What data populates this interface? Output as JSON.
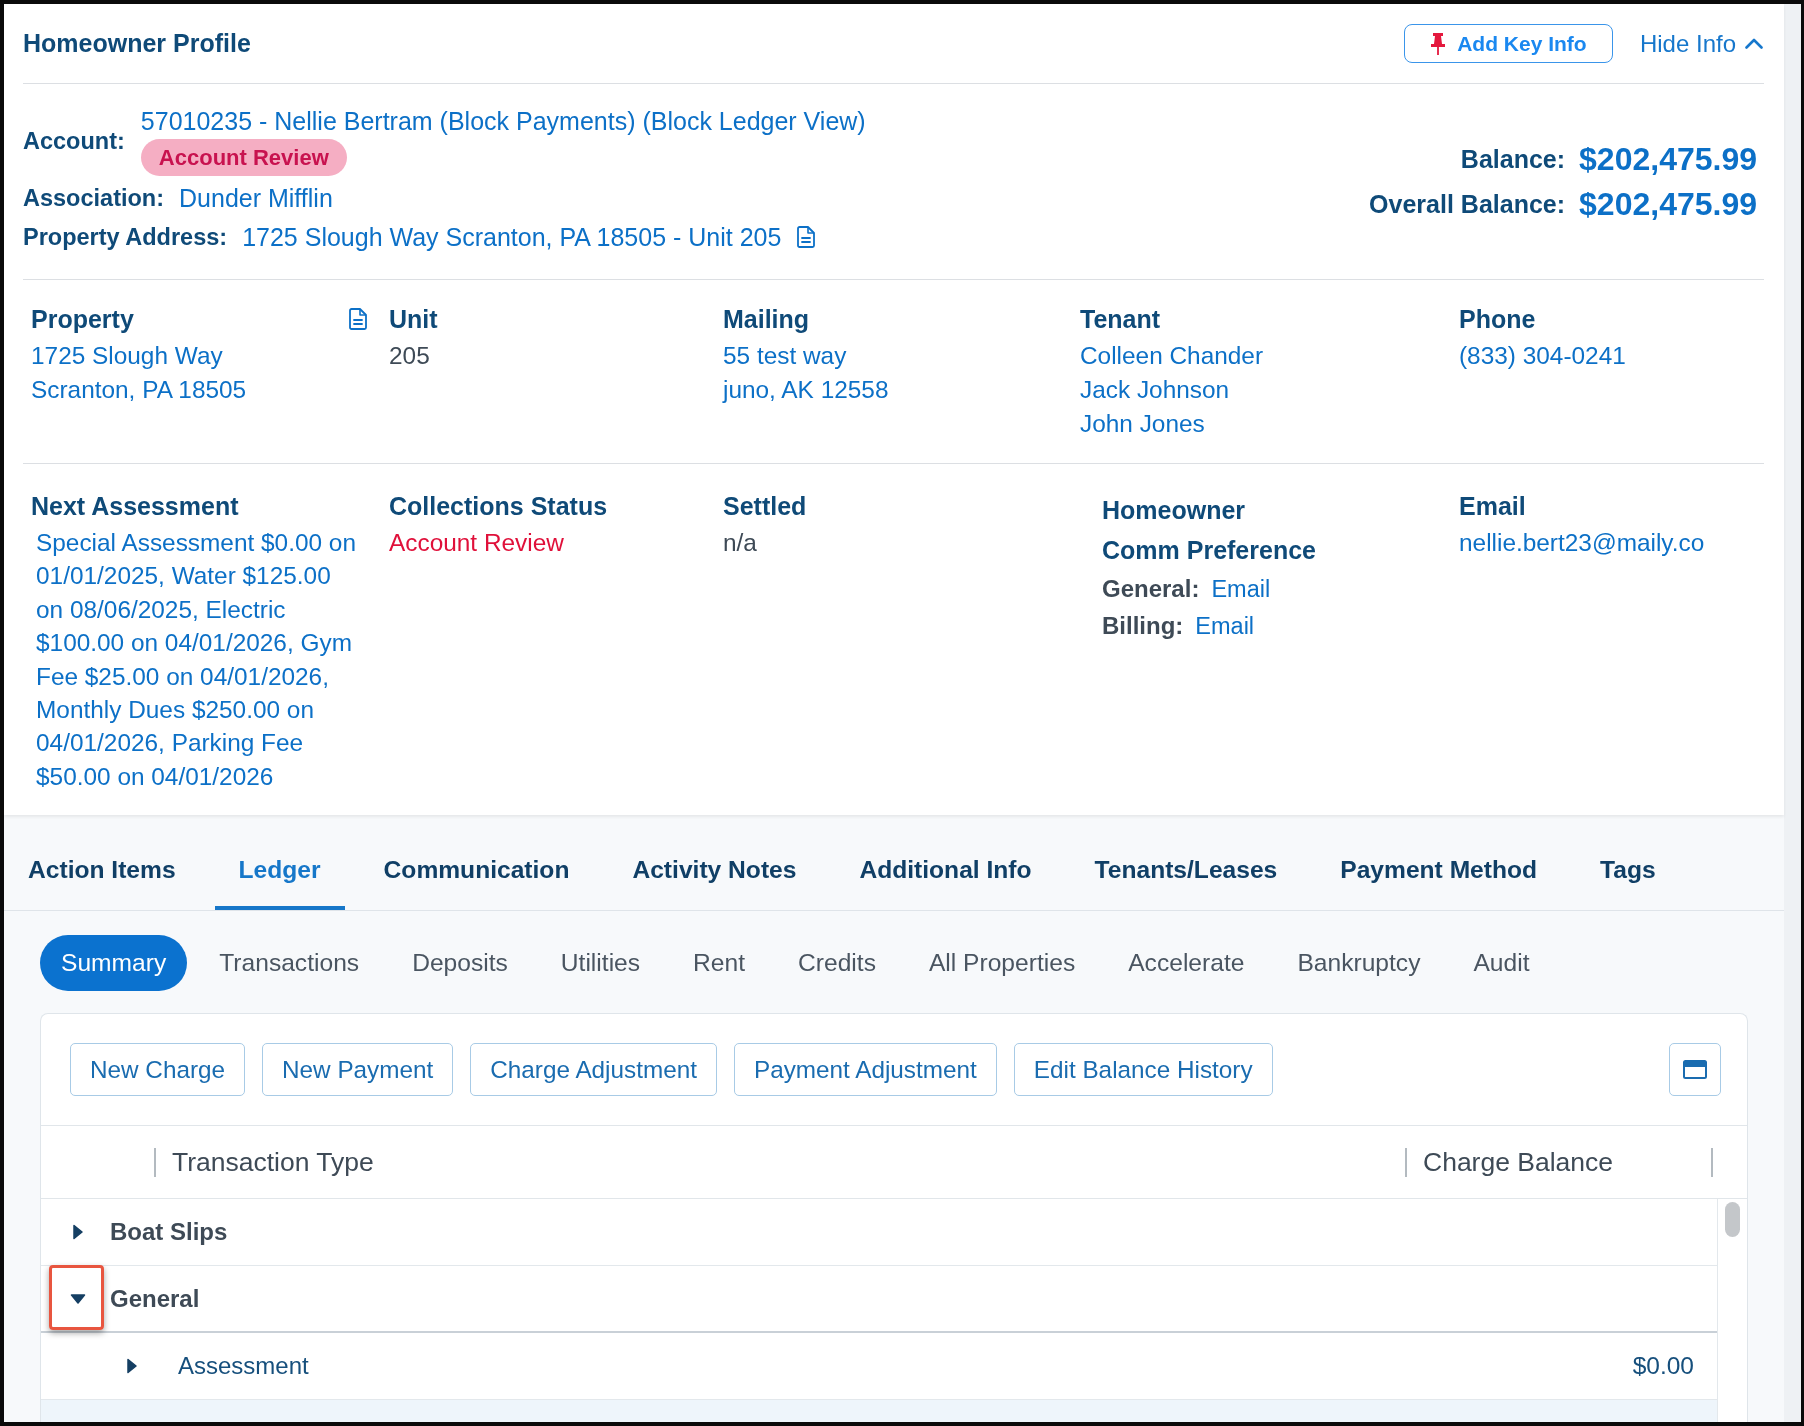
{
  "header": {
    "title": "Homeowner Profile",
    "add_key_info": "Add Key Info",
    "hide_info": "Hide Info"
  },
  "account": {
    "label": "Account:",
    "value": "57010235 - Nellie Bertram (Block Payments) (Block Ledger View)",
    "badge": "Account Review"
  },
  "association": {
    "label": "Association:",
    "value": "Dunder Mifflin"
  },
  "property_address": {
    "label": "Property Address:",
    "value": "1725 Slough Way Scranton, PA 18505 - Unit 205"
  },
  "balances": [
    {
      "label": "Balance:",
      "value": "$202,475.99"
    },
    {
      "label": "Overall Balance:",
      "value": "$202,475.99"
    }
  ],
  "details_rows": [
    [
      {
        "kind": "links",
        "heading": "Property",
        "doc_icon": true,
        "lines": [
          "1725 Slough Way",
          "Scranton, PA 18505"
        ]
      },
      {
        "kind": "text",
        "heading": "Unit",
        "lines": [
          "205"
        ]
      },
      {
        "kind": "links",
        "heading": "Mailing",
        "lines": [
          "55 test way",
          "juno, AK 12558"
        ]
      },
      {
        "kind": "links",
        "heading": "Tenant",
        "lines": [
          "Colleen Chander",
          "Jack Johnson",
          "John Jones"
        ]
      },
      {
        "kind": "links",
        "heading": "Phone",
        "lines": [
          "(833) 304-0241"
        ]
      }
    ],
    [
      {
        "kind": "links",
        "heading": "Next Assessment",
        "lines": [
          "Special Assessment $0.00 on 01/01/2025, Water $125.00 on 08/06/2025, Electric $100.00 on 04/01/2026, Gym Fee $25.00 on 04/01/2026, Monthly Dues $250.00 on 04/01/2026, Parking Fee $50.00 on 04/01/2026"
        ]
      },
      {
        "kind": "status",
        "heading": "Collections Status",
        "lines": [
          "Account Review"
        ]
      },
      {
        "kind": "text",
        "heading": "Settled",
        "lines": [
          "n/a"
        ]
      },
      {
        "kind": "preferences",
        "heading_lines": [
          "Homeowner",
          "Comm Preference"
        ],
        "preferences": [
          {
            "label": "General:",
            "value": "Email"
          },
          {
            "label": "Billing:",
            "value": "Email"
          }
        ]
      },
      {
        "kind": "links",
        "heading": "Email",
        "lines": [
          "nellie.bert23@maily.co"
        ]
      }
    ]
  ],
  "tabs": [
    {
      "label": "Action Items",
      "selected": false
    },
    {
      "label": "Ledger",
      "selected": true
    },
    {
      "label": "Communication",
      "selected": false
    },
    {
      "label": "Activity Notes",
      "selected": false
    },
    {
      "label": "Additional Info",
      "selected": false
    },
    {
      "label": "Tenants/Leases",
      "selected": false
    },
    {
      "label": "Payment Method",
      "selected": false
    },
    {
      "label": "Tags",
      "selected": false
    }
  ],
  "subtabs": [
    {
      "label": "Summary",
      "selected": true
    },
    {
      "label": "Transactions",
      "selected": false
    },
    {
      "label": "Deposits",
      "selected": false
    },
    {
      "label": "Utilities",
      "selected": false
    },
    {
      "label": "Rent",
      "selected": false
    },
    {
      "label": "Credits",
      "selected": false
    },
    {
      "label": "All Properties",
      "selected": false
    },
    {
      "label": "Accelerate",
      "selected": false
    },
    {
      "label": "Bankruptcy",
      "selected": false
    },
    {
      "label": "Audit",
      "selected": false
    }
  ],
  "toolbar": {
    "buttons": [
      "New Charge",
      "New Payment",
      "Charge Adjustment",
      "Payment Adjustment",
      "Edit Balance History"
    ]
  },
  "table": {
    "columns": [
      "Transaction Type",
      "Charge Balance"
    ],
    "rows": [
      {
        "label": "Boat Slips",
        "expanded": false
      },
      {
        "label": "General",
        "expanded": true,
        "highlighted": true,
        "children": [
          {
            "label": "Assessment",
            "expanded": false,
            "charge_balance": "$0.00"
          }
        ]
      }
    ]
  }
}
